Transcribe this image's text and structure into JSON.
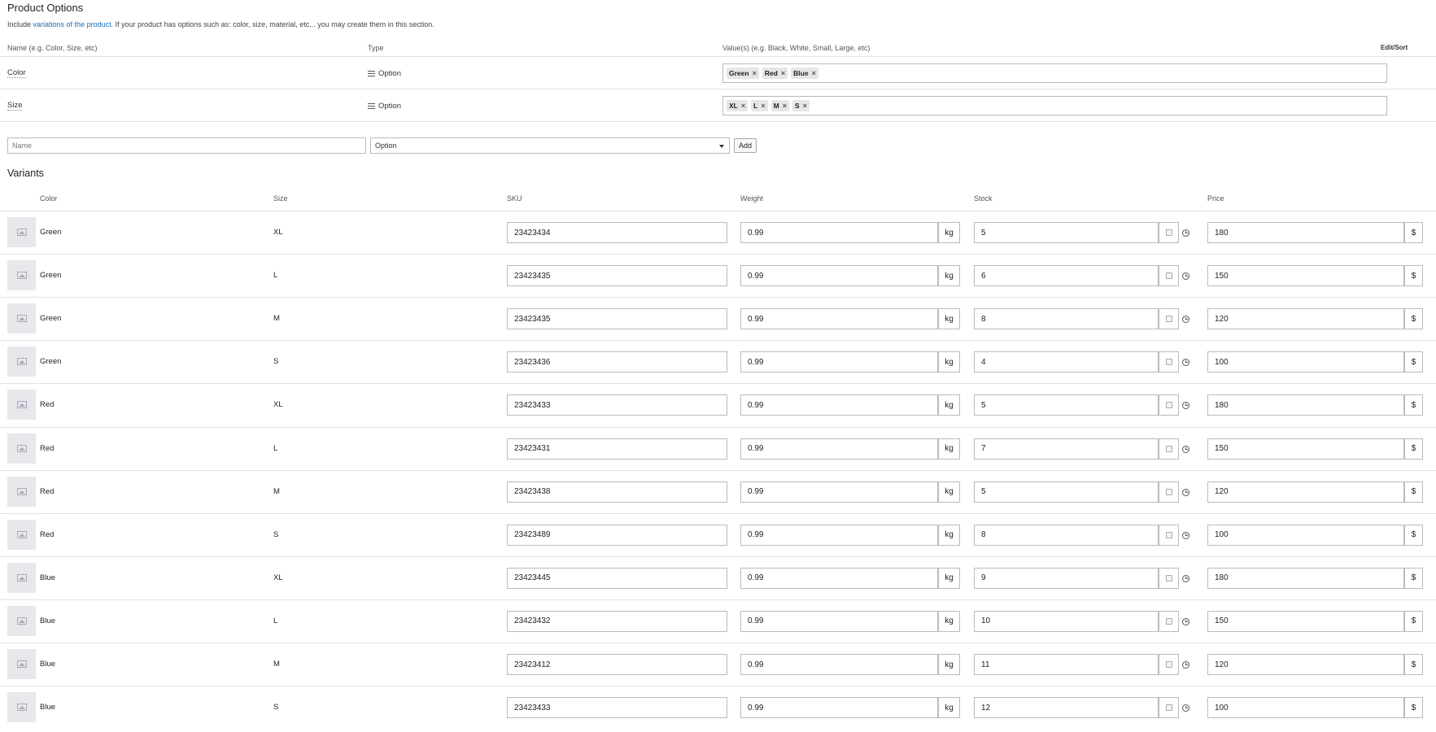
{
  "options": {
    "title": "Product Options",
    "desc_prefix": "Include ",
    "desc_link": "variations of the product",
    "desc_suffix": ". If your product has options such as: color, size, material, etc... you may create them in this section.",
    "col_name": "Name (e.g. Color, Size, etc)",
    "col_type": "Type",
    "col_values": "Value(s) (e.g. Black, White, Small, Large, etc)",
    "edit_sort": "Edit/Sort",
    "rows": [
      {
        "name": "Color",
        "type": "Option",
        "values": [
          "Green",
          "Red",
          "Blue"
        ]
      },
      {
        "name": "Size",
        "type": "Option",
        "values": [
          "XL",
          "L",
          "M",
          "S"
        ]
      }
    ],
    "new_name_placeholder": "Name",
    "new_type_value": "Option",
    "add_label": "Add",
    "remove_glyph": "×"
  },
  "variants": {
    "title": "Variants",
    "headers": {
      "color": "Color",
      "size": "Size",
      "sku": "SKU",
      "weight": "Weight",
      "stock": "Stock",
      "price": "Price"
    },
    "weight_unit": "kg",
    "currency": "$",
    "rows": [
      {
        "color": "Green",
        "size": "XL",
        "sku": "23423434",
        "weight": "0.99",
        "stock": "5",
        "price": "180"
      },
      {
        "color": "Green",
        "size": "L",
        "sku": "23423435",
        "weight": "0.99",
        "stock": "6",
        "price": "150"
      },
      {
        "color": "Green",
        "size": "M",
        "sku": "23423435",
        "weight": "0.99",
        "stock": "8",
        "price": "120"
      },
      {
        "color": "Green",
        "size": "S",
        "sku": "23423436",
        "weight": "0.99",
        "stock": "4",
        "price": "100"
      },
      {
        "color": "Red",
        "size": "XL",
        "sku": "23423433",
        "weight": "0.99",
        "stock": "5",
        "price": "180"
      },
      {
        "color": "Red",
        "size": "L",
        "sku": "23423431",
        "weight": "0.99",
        "stock": "7",
        "price": "150"
      },
      {
        "color": "Red",
        "size": "M",
        "sku": "23423438",
        "weight": "0.99",
        "stock": "5",
        "price": "120"
      },
      {
        "color": "Red",
        "size": "S",
        "sku": "23423489",
        "weight": "0.99",
        "stock": "8",
        "price": "100"
      },
      {
        "color": "Blue",
        "size": "XL",
        "sku": "23423445",
        "weight": "0.99",
        "stock": "9",
        "price": "180"
      },
      {
        "color": "Blue",
        "size": "L",
        "sku": "23423432",
        "weight": "0.99",
        "stock": "10",
        "price": "150"
      },
      {
        "color": "Blue",
        "size": "M",
        "sku": "23423412",
        "weight": "0.99",
        "stock": "11",
        "price": "120"
      },
      {
        "color": "Blue",
        "size": "S",
        "sku": "23423433",
        "weight": "0.99",
        "stock": "12",
        "price": "100"
      }
    ]
  }
}
